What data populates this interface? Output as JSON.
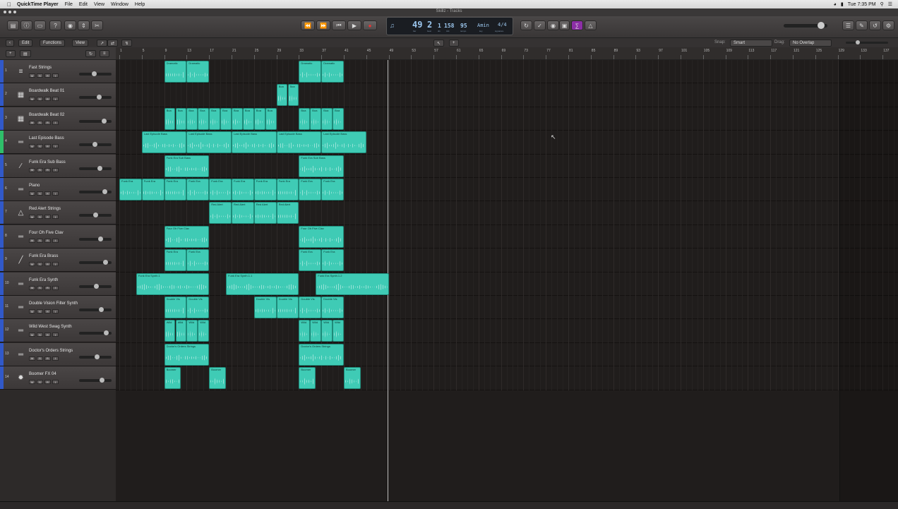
{
  "menubar": {
    "app_name": "QuickTime Player",
    "menus": [
      "File",
      "Edit",
      "View",
      "Window",
      "Help"
    ],
    "clock": "Tue 7:35 PM"
  },
  "window": {
    "title": "Skillz - Tracks"
  },
  "lcd": {
    "bar": "49",
    "beat": "2",
    "division": "1",
    "tick": "158",
    "tempo": "95",
    "key": "Amin",
    "signature": "4/4",
    "labels": {
      "bar": "bar",
      "beat": "beat",
      "div": "div",
      "tick": "tick",
      "tempo": "tempo",
      "key": "key",
      "sig": "signature"
    }
  },
  "subbar": {
    "edit": "Edit",
    "functions": "Functions",
    "view": "View",
    "snap_label": "Snap:",
    "snap_value": "Smart",
    "drag_label": "Drag:",
    "drag_value": "No Overlap"
  },
  "ruler_ticks": [
    "1",
    "5",
    "9",
    "13",
    "17",
    "21",
    "25",
    "29",
    "33",
    "37",
    "41",
    "45",
    "49",
    "53",
    "57",
    "61",
    "65",
    "69",
    "73",
    "77",
    "81",
    "85",
    "89",
    "93",
    "97",
    "101",
    "105",
    "109",
    "113",
    "117",
    "121",
    "125",
    "129",
    "133",
    "137"
  ],
  "buttons": {
    "solo": "S",
    "record": "R",
    "input": "I",
    "mute": "M"
  },
  "colors": {
    "region": "#3fcbb5",
    "region_border": "#1f8a79",
    "track_stripe": "#3159c9",
    "track_stripe_selected": "#2fbf6a"
  },
  "tracks": [
    {
      "num": "1",
      "name": "Fast Strings",
      "icon": "strings-icon",
      "glyph": "≡"
    },
    {
      "num": "2",
      "name": "Boardwalk Beat 01",
      "icon": "drum-machine-icon",
      "glyph": "▦"
    },
    {
      "num": "3",
      "name": "Boardwalk Beat 02",
      "icon": "drum-machine-icon",
      "glyph": "▦"
    },
    {
      "num": "4",
      "name": "Last Episode Bass",
      "icon": "synth-icon",
      "glyph": "═"
    },
    {
      "num": "5",
      "name": "Funk Era Sub Bass",
      "icon": "bass-guitar-icon",
      "glyph": "∕"
    },
    {
      "num": "6",
      "name": "Piano",
      "icon": "keyboard-icon",
      "glyph": "═"
    },
    {
      "num": "7",
      "name": "Red Alert Strings",
      "icon": "harp-icon",
      "glyph": "△"
    },
    {
      "num": "8",
      "name": "Four Oh Five Clav",
      "icon": "keyboard-icon",
      "glyph": "═"
    },
    {
      "num": "9",
      "name": "Funk Era Brass",
      "icon": "trumpet-icon",
      "glyph": "╱"
    },
    {
      "num": "10",
      "name": "Funk Era Synth",
      "icon": "synth-icon",
      "glyph": "═"
    },
    {
      "num": "11",
      "name": "Double Vision Filter Synth",
      "icon": "synth-icon",
      "glyph": "═"
    },
    {
      "num": "12",
      "name": "Wild West Swag Synth",
      "icon": "synth-icon",
      "glyph": "═"
    },
    {
      "num": "13",
      "name": "Doctor's Orders Strings",
      "icon": "synth-icon",
      "glyph": "═"
    },
    {
      "num": "14",
      "name": "Boomer FX 04",
      "icon": "fx-burst-icon",
      "glyph": "✹"
    }
  ],
  "regions": [
    {
      "track": 0,
      "start": 9,
      "len": 4,
      "name": "Dramatic"
    },
    {
      "track": 0,
      "start": 13,
      "len": 4,
      "name": "Dramatic"
    },
    {
      "track": 0,
      "start": 33,
      "len": 4,
      "name": "Dramatic"
    },
    {
      "track": 0,
      "start": 37,
      "len": 4,
      "name": "Dramatic"
    },
    {
      "track": 1,
      "start": 29,
      "len": 2,
      "name": "Boa"
    },
    {
      "track": 1,
      "start": 31,
      "len": 2,
      "name": "Boa"
    },
    {
      "track": 2,
      "start": 9,
      "len": 2,
      "name": "Boa"
    },
    {
      "track": 2,
      "start": 11,
      "len": 2,
      "name": "Boa"
    },
    {
      "track": 2,
      "start": 13,
      "len": 2,
      "name": "Boa"
    },
    {
      "track": 2,
      "start": 15,
      "len": 2,
      "name": "Boa"
    },
    {
      "track": 2,
      "start": 17,
      "len": 2,
      "name": "Boa"
    },
    {
      "track": 2,
      "start": 19,
      "len": 2,
      "name": "Boa"
    },
    {
      "track": 2,
      "start": 21,
      "len": 2,
      "name": "Boa"
    },
    {
      "track": 2,
      "start": 23,
      "len": 2,
      "name": "Boa"
    },
    {
      "track": 2,
      "start": 25,
      "len": 2,
      "name": "Boa"
    },
    {
      "track": 2,
      "start": 27,
      "len": 2,
      "name": "Boa"
    },
    {
      "track": 2,
      "start": 33,
      "len": 2,
      "name": "Boa"
    },
    {
      "track": 2,
      "start": 35,
      "len": 2,
      "name": "Boa"
    },
    {
      "track": 2,
      "start": 37,
      "len": 2,
      "name": "Boa"
    },
    {
      "track": 2,
      "start": 39,
      "len": 2,
      "name": "Boa"
    },
    {
      "track": 3,
      "start": 5,
      "len": 8,
      "name": "Last Episode Bass"
    },
    {
      "track": 3,
      "start": 13,
      "len": 8,
      "name": "Last Episode Bass"
    },
    {
      "track": 3,
      "start": 21,
      "len": 8,
      "name": "Last Episode Bass"
    },
    {
      "track": 3,
      "start": 29,
      "len": 8,
      "name": "Last Episode Bass"
    },
    {
      "track": 3,
      "start": 37,
      "len": 8,
      "name": "Last Episode Bass"
    },
    {
      "track": 4,
      "start": 9,
      "len": 8,
      "name": "Funk Era Sub Bass"
    },
    {
      "track": 4,
      "start": 33,
      "len": 8,
      "name": "Funk Era Sub Bass"
    },
    {
      "track": 5,
      "start": 1,
      "len": 4,
      "name": "Funk Era"
    },
    {
      "track": 5,
      "start": 5,
      "len": 4,
      "name": "Funk Era"
    },
    {
      "track": 5,
      "start": 9,
      "len": 4,
      "name": "Funk Era"
    },
    {
      "track": 5,
      "start": 13,
      "len": 4,
      "name": "Funk Era"
    },
    {
      "track": 5,
      "start": 17,
      "len": 4,
      "name": "Funk Era"
    },
    {
      "track": 5,
      "start": 21,
      "len": 4,
      "name": "Funk Era"
    },
    {
      "track": 5,
      "start": 25,
      "len": 4,
      "name": "Funk Era"
    },
    {
      "track": 5,
      "start": 29,
      "len": 4,
      "name": "Funk Era"
    },
    {
      "track": 5,
      "start": 33,
      "len": 4,
      "name": "Funk Era"
    },
    {
      "track": 5,
      "start": 37,
      "len": 4,
      "name": "Funk Era"
    },
    {
      "track": 6,
      "start": 17,
      "len": 4,
      "name": "Red Alert"
    },
    {
      "track": 6,
      "start": 21,
      "len": 4,
      "name": "Red Alert"
    },
    {
      "track": 6,
      "start": 25,
      "len": 4,
      "name": "Red Alert"
    },
    {
      "track": 6,
      "start": 29,
      "len": 4,
      "name": "Red Alert"
    },
    {
      "track": 7,
      "start": 9,
      "len": 8,
      "name": "Four Oh Five Clav"
    },
    {
      "track": 7,
      "start": 33,
      "len": 8,
      "name": "Four Oh Five Clav"
    },
    {
      "track": 8,
      "start": 9,
      "len": 4,
      "name": "Funk Era"
    },
    {
      "track": 8,
      "start": 13,
      "len": 4,
      "name": "Funk Era"
    },
    {
      "track": 8,
      "start": 33,
      "len": 4,
      "name": "Funk Era"
    },
    {
      "track": 8,
      "start": 37,
      "len": 4,
      "name": "Funk Era"
    },
    {
      "track": 9,
      "start": 4,
      "len": 13,
      "name": "Funk Era Synth.1"
    },
    {
      "track": 9,
      "start": 20,
      "len": 13,
      "name": "Funk Era Synth.1.1"
    },
    {
      "track": 9,
      "start": 36,
      "len": 13,
      "name": "Funk Era Synth.1.2"
    },
    {
      "track": 10,
      "start": 9,
      "len": 4,
      "name": "Double Vis"
    },
    {
      "track": 10,
      "start": 13,
      "len": 4,
      "name": "Double Vis"
    },
    {
      "track": 10,
      "start": 25,
      "len": 4,
      "name": "Double Vis"
    },
    {
      "track": 10,
      "start": 29,
      "len": 4,
      "name": "Double Vis"
    },
    {
      "track": 10,
      "start": 33,
      "len": 4,
      "name": "Double Vis"
    },
    {
      "track": 10,
      "start": 37,
      "len": 4,
      "name": "Double Vis"
    },
    {
      "track": 11,
      "start": 9,
      "len": 2,
      "name": "Wild"
    },
    {
      "track": 11,
      "start": 11,
      "len": 2,
      "name": "Wild"
    },
    {
      "track": 11,
      "start": 13,
      "len": 2,
      "name": "Wild"
    },
    {
      "track": 11,
      "start": 15,
      "len": 2,
      "name": "Wild"
    },
    {
      "track": 11,
      "start": 33,
      "len": 2,
      "name": "Wild"
    },
    {
      "track": 11,
      "start": 35,
      "len": 2,
      "name": "Wild"
    },
    {
      "track": 11,
      "start": 37,
      "len": 2,
      "name": "Wild"
    },
    {
      "track": 11,
      "start": 39,
      "len": 2,
      "name": "Wild"
    },
    {
      "track": 12,
      "start": 9,
      "len": 8,
      "name": "Doctor's Orders Strings"
    },
    {
      "track": 12,
      "start": 33,
      "len": 8,
      "name": "Doctor's Orders Strings"
    },
    {
      "track": 13,
      "start": 9,
      "len": 3,
      "name": "Boomer"
    },
    {
      "track": 13,
      "start": 17,
      "len": 3,
      "name": "Boomer"
    },
    {
      "track": 13,
      "start": 33,
      "len": 3,
      "name": "Boomer"
    },
    {
      "track": 13,
      "start": 41,
      "len": 3,
      "name": "Boomer"
    }
  ]
}
